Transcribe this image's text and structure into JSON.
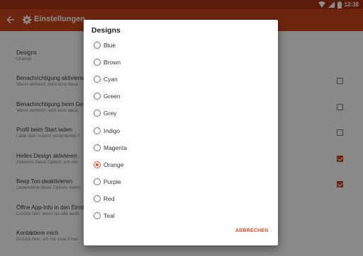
{
  "statusbar": {
    "time": "12:38"
  },
  "toolbar": {
    "title": "Einstellungen"
  },
  "settings": [
    {
      "title": "Designs",
      "summary": "Orange"
    },
    {
      "title": "Benachrichtigung aktivieren",
      "summary": "Wenn aktiviert, wird eine daue"
    },
    {
      "title": "Benachrichtigung beim Ge",
      "summary": "Wenn aktiviert, wird eine daue"
    },
    {
      "title": "Profil beim Start laden",
      "summary": "Lade dein zuletzt verändertes I"
    },
    {
      "title": "Helles Design aktivieren",
      "summary": "Aktiviere diese Option, um ein"
    },
    {
      "title": "Beep Ton deaktivieren",
      "summary": "Deaktiviere diese Option, wenn"
    },
    {
      "title": "Öffne App-Info in den Einst",
      "summary": "Drücke hier, wenn du alle laufe"
    },
    {
      "title": "Kontaktiere mich",
      "summary": "Drücke hier, um mir eine Emai"
    }
  ],
  "dialog": {
    "title": "Designs",
    "selected": "Orange",
    "options": [
      "Blue",
      "Brown",
      "Cyan",
      "Green",
      "Grey",
      "Indigo",
      "Magenta",
      "Orange",
      "Purple",
      "Red",
      "Teal"
    ],
    "cancel_label": "ABBRECHEN"
  },
  "colors": {
    "primary": "#c9461e",
    "primary_dark": "#a8310f",
    "accent": "#e65126"
  }
}
